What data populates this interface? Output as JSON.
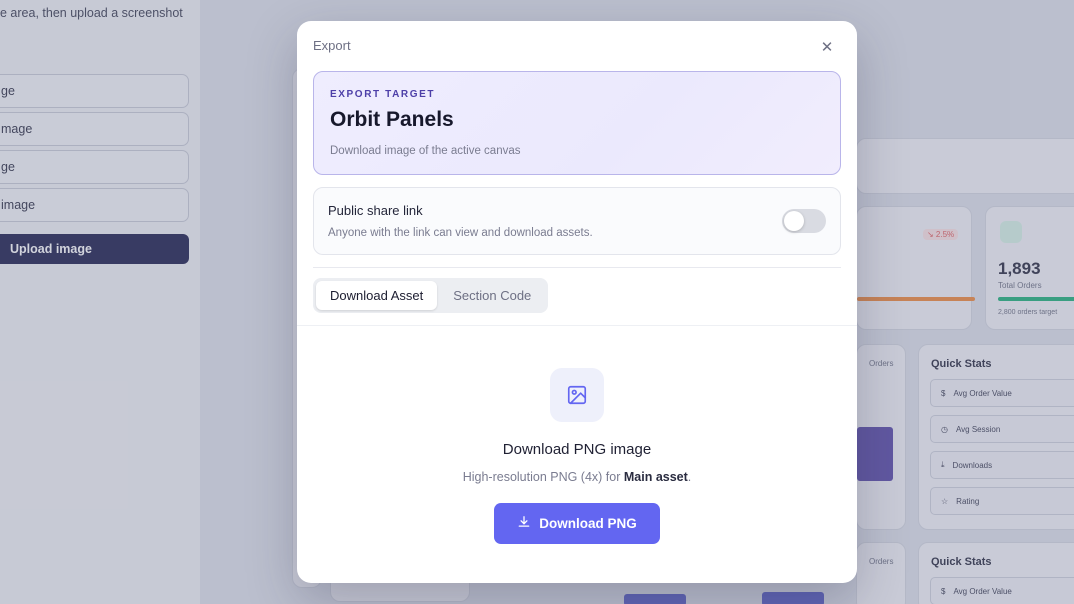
{
  "background": {
    "hint": "e area, then upload a screenshot",
    "buttons": [
      "ge",
      "mage",
      "ge",
      "image"
    ],
    "upload_label": "Upload image",
    "stat_badge": "↘ 2.5%",
    "total_orders_value": "1,893",
    "total_orders_label": "Total Orders",
    "orders_target": "2,800 orders target",
    "legend_orders": "Orders",
    "quick_stats_title": "Quick Stats",
    "quick_stats": [
      "Avg Order Value",
      "Avg Session",
      "Downloads",
      "Rating"
    ],
    "quick_stats_2": [
      "Avg Order Value"
    ],
    "accent": "#1e1f4d"
  },
  "modal": {
    "title": "Export",
    "close_icon": "close-icon",
    "target": {
      "eyebrow": "EXPORT TARGET",
      "name": "Orbit Panels",
      "description": "Download image of the active canvas"
    },
    "share": {
      "title": "Public share link",
      "description": "Anyone with the link can view and download assets.",
      "enabled": false
    },
    "tabs": [
      {
        "label": "Download Asset",
        "active": true
      },
      {
        "label": "Section Code",
        "active": false
      }
    ],
    "download": {
      "icon": "image-icon",
      "title": "Download PNG image",
      "desc_prefix": "High-resolution PNG (4x) for ",
      "desc_bold": "Main asset",
      "desc_suffix": ".",
      "button_label": "Download PNG",
      "button_icon": "download-icon"
    },
    "accent": "#6366f1"
  }
}
